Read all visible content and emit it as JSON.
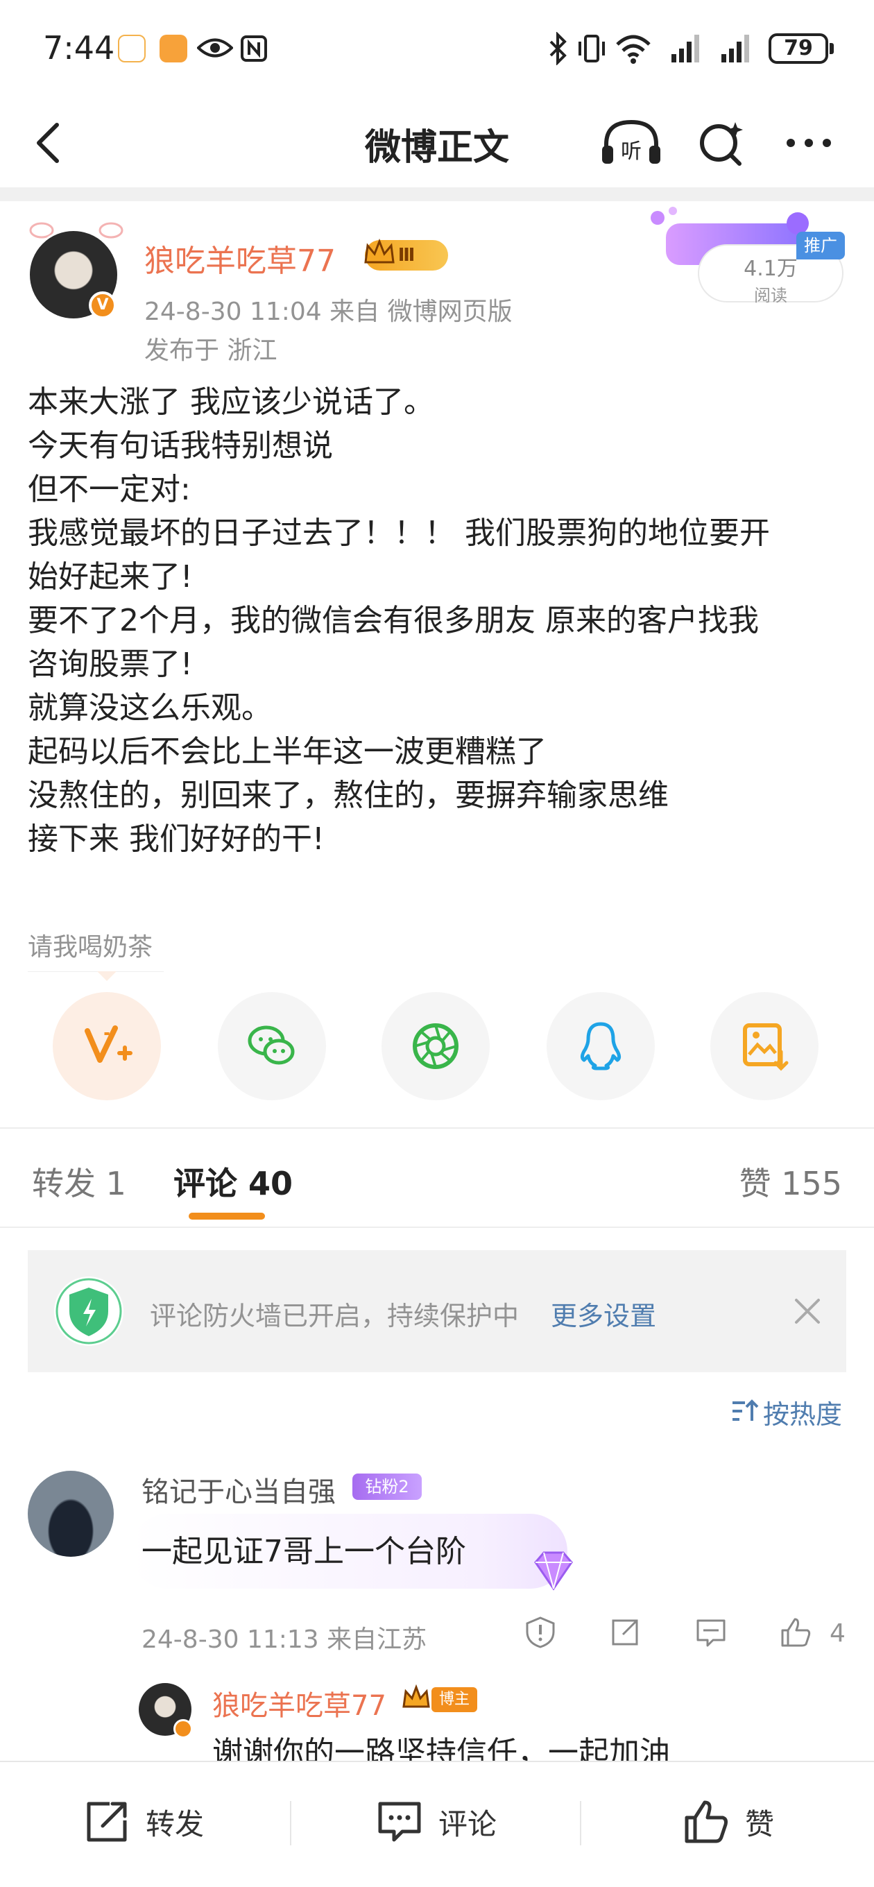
{
  "status_bar": {
    "time": "7:44",
    "battery": "79"
  },
  "nav": {
    "title": "微博正文",
    "listen_label": "听"
  },
  "post": {
    "author": "狼吃羊吃草77",
    "level": "Ⅲ",
    "timestamp_source": "24-8-30 11:04  来自 微博网页版",
    "location": "发布于 浙江",
    "read_count": "4.1万",
    "read_label": "阅读",
    "promo_tag": "推广",
    "lines": [
      "本来大涨了 我应该少说话了。",
      "今天有句话我特别想说",
      "但不一定对:",
      "我感觉最坏的日子过去了！！！ 我们股票狗的地位要开",
      "始好起来了!",
      "要不了2个月，我的微信会有很多朋友 原来的客户找我",
      "咨询股票了!",
      "就算没这么乐观。",
      "起码以后不会比上半年这一波更糟糕了",
      "没熬住的，别回来了，熬住的，要摒弃输家思维",
      "接下来 我们好好的干!"
    ],
    "tip_label": "请我喝奶茶"
  },
  "share": [
    "v-plus-icon",
    "wechat-icon",
    "moments-icon",
    "qq-icon",
    "save-image-icon"
  ],
  "tabs": {
    "repost": "转发 1",
    "comment": "评论 40",
    "like": "赞 155"
  },
  "firewall": {
    "text": "评论防火墙已开启，持续保护中",
    "link": "更多设置"
  },
  "sort": {
    "label": "按热度"
  },
  "comment1": {
    "name": "铭记于心当自强",
    "badge": "钻粉2",
    "text": "一起见证7哥上一个台阶",
    "meta": "24-8-30 11:13  来自江苏",
    "likes": "4"
  },
  "reply": {
    "name": "狼吃羊吃草77",
    "role": "博主",
    "text": "谢谢你的一路坚持信任，一起加油"
  },
  "bottom_bar": {
    "repost": "转发",
    "comment": "评论",
    "like": "赞"
  },
  "colors": {
    "accent": "#f28e1c",
    "username": "#eb7350",
    "link": "#507daf"
  }
}
